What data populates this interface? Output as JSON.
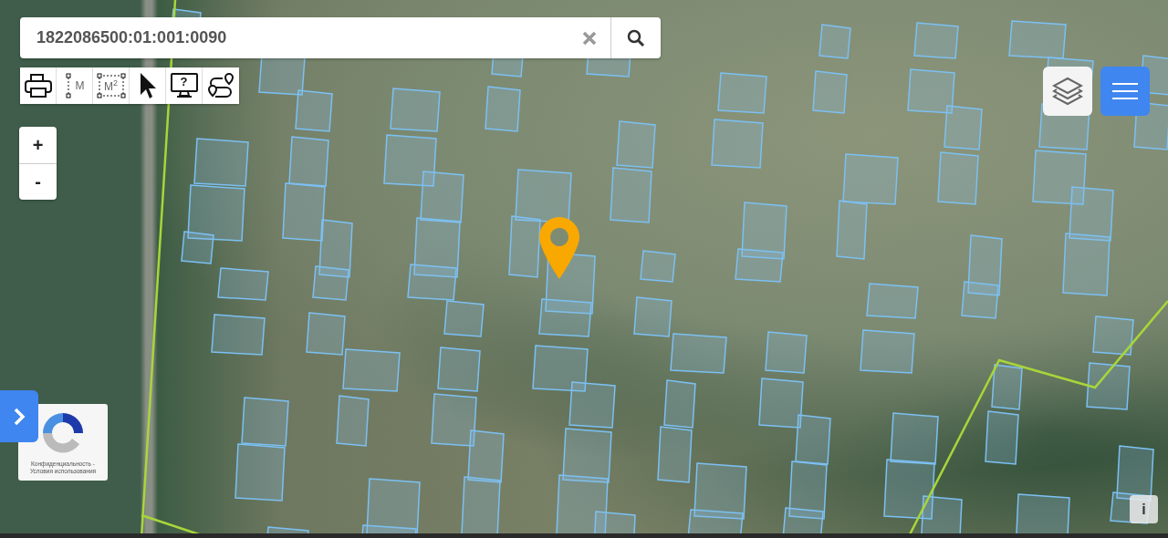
{
  "search": {
    "value": "1822086500:01:001:0090"
  },
  "tools": [
    {
      "kind": "print"
    },
    {
      "kind": "distance",
      "label": "M"
    },
    {
      "kind": "area",
      "label": "M$^{2}$"
    },
    {
      "kind": "pointer"
    },
    {
      "kind": "help",
      "label": "?"
    },
    {
      "kind": "route"
    }
  ],
  "zoom": {
    "in": "+",
    "out": "-"
  },
  "captcha": {
    "lines": [
      "Конфиденциальность -",
      "Условия использования"
    ]
  },
  "info": "i"
}
